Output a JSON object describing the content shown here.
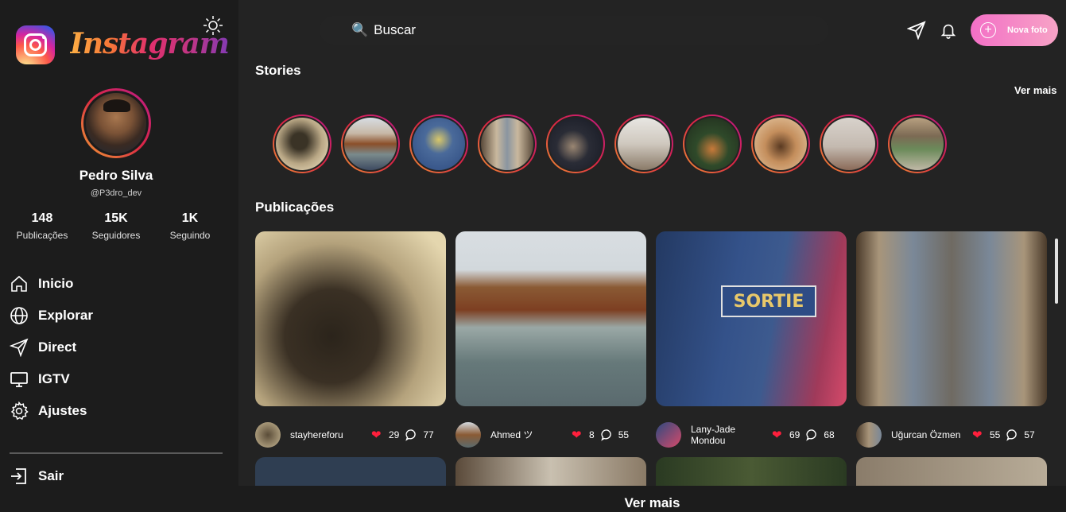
{
  "app": {
    "logo_text": "Instagram"
  },
  "profile": {
    "name": "Pedro Silva",
    "handle": "@P3dro_dev",
    "stats": [
      {
        "value": "148",
        "label": "Publicações"
      },
      {
        "value": "15K",
        "label": "Seguidores"
      },
      {
        "value": "1K",
        "label": "Seguindo"
      }
    ]
  },
  "nav": {
    "items": [
      {
        "label": "Inicio",
        "icon": "home-icon"
      },
      {
        "label": "Explorar",
        "icon": "globe-icon"
      },
      {
        "label": "Direct",
        "icon": "send-icon"
      },
      {
        "label": "IGTV",
        "icon": "monitor-icon"
      },
      {
        "label": "Ajustes",
        "icon": "gear-icon"
      }
    ],
    "logout": {
      "label": "Sair",
      "icon": "logout-icon"
    }
  },
  "header": {
    "search_placeholder": "Buscar",
    "new_photo_label": "Nova foto"
  },
  "stories": {
    "title": "Stories",
    "see_more": "Ver mais",
    "count": 10
  },
  "posts": {
    "title": "Publicações",
    "see_more": "Ver mais",
    "items": [
      {
        "user": "stayhereforu",
        "likes": "29",
        "comments": "77"
      },
      {
        "user": "Ahmed ツ",
        "likes": "8",
        "comments": "55"
      },
      {
        "user": "Lany-Jade Mondou",
        "likes": "69",
        "comments": "68",
        "image_text": "SORTIE"
      },
      {
        "user": "Uğurcan Özmen",
        "likes": "55",
        "comments": "57"
      }
    ]
  },
  "colors": {
    "background": "#232323",
    "sidebar": "#1c1c1c",
    "accent_gradient_start": "#f36fc6",
    "heart": "#ff1f3c"
  }
}
